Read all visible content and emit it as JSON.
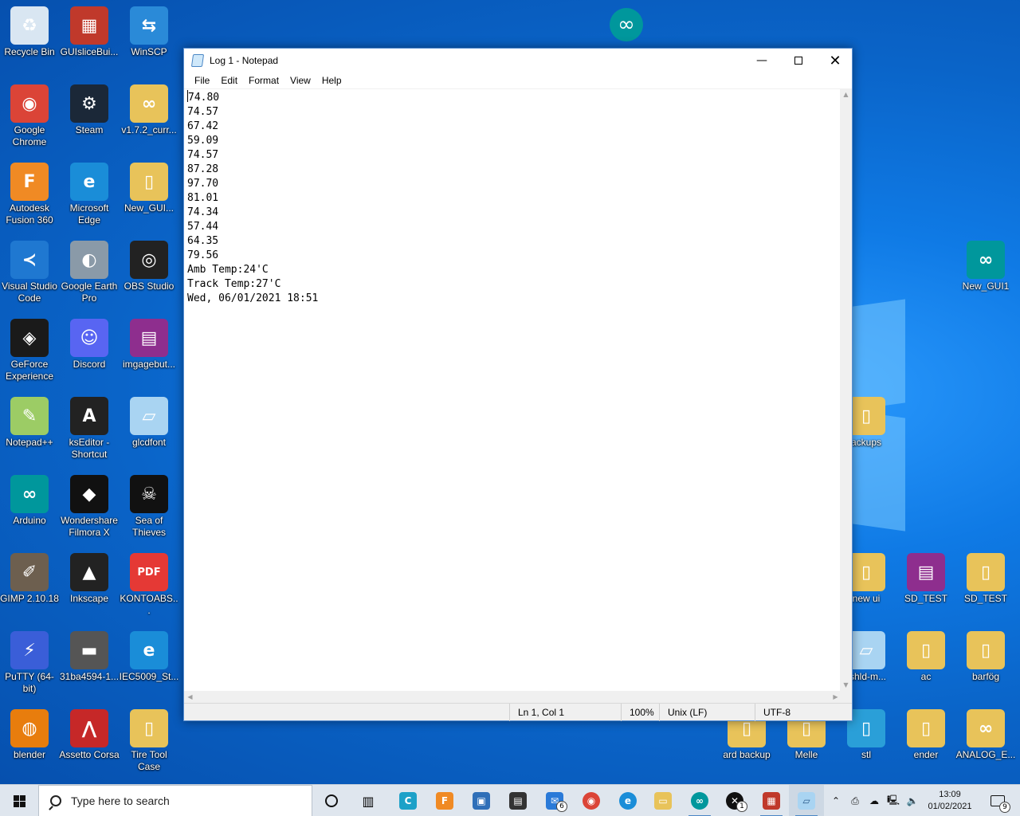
{
  "desktop": {
    "icons": [
      {
        "label": "Recycle Bin",
        "icon": "recycle-bin-icon",
        "color": "#d9e6f2",
        "glyph": "♻"
      },
      {
        "label": "GUIsliceBui...",
        "icon": "guislice-builder-icon",
        "color": "#c0392b",
        "glyph": "▦"
      },
      {
        "label": "WinSCP",
        "icon": "winscp-icon",
        "color": "#2a8ad8",
        "glyph": "⇆"
      },
      {
        "label": "Google Chrome",
        "icon": "chrome-icon",
        "color": "#db4437",
        "glyph": "◉"
      },
      {
        "label": "Steam",
        "icon": "steam-icon",
        "color": "#1b2838",
        "glyph": "⚙"
      },
      {
        "label": "v1.7.2_curr...",
        "icon": "folder-arduino-icon",
        "color": "#e8c35a",
        "glyph": "∞"
      },
      {
        "label": "Autodesk Fusion 360",
        "icon": "fusion360-icon",
        "color": "#f08a24",
        "glyph": "F"
      },
      {
        "label": "Microsoft Edge",
        "icon": "edge-icon",
        "color": "#1a8dd8",
        "glyph": "e"
      },
      {
        "label": "New_GUI...",
        "icon": "folder-icon",
        "color": "#e8c35a",
        "glyph": "▯"
      },
      {
        "label": "Visual Studio Code",
        "icon": "vscode-icon",
        "color": "#1f78d1",
        "glyph": "≺"
      },
      {
        "label": "Google Earth Pro",
        "icon": "google-earth-icon",
        "color": "#8a9aa8",
        "glyph": "◐"
      },
      {
        "label": "OBS Studio",
        "icon": "obs-icon",
        "color": "#222222",
        "glyph": "◎"
      },
      {
        "label": "GeForce Experience",
        "icon": "geforce-icon",
        "color": "#1a1a1a",
        "glyph": "◈"
      },
      {
        "label": "Discord",
        "icon": "discord-icon",
        "color": "#5865f2",
        "glyph": "☺"
      },
      {
        "label": "imgagebut...",
        "icon": "winrar-icon",
        "color": "#8e2e8e",
        "glyph": "▤"
      },
      {
        "label": "Notepad++",
        "icon": "notepadpp-icon",
        "color": "#9ccc65",
        "glyph": "✎"
      },
      {
        "label": "ksEditor - Shortcut",
        "icon": "kseditor-icon",
        "color": "#222222",
        "glyph": "A"
      },
      {
        "label": "glcdfont",
        "icon": "notepad-file-icon",
        "color": "#a9d4f2",
        "glyph": "▱"
      },
      {
        "label": "Arduino",
        "icon": "arduino-icon",
        "color": "#00979c",
        "glyph": "∞"
      },
      {
        "label": "Wondershare Filmora X",
        "icon": "filmora-icon",
        "color": "#111111",
        "glyph": "◆"
      },
      {
        "label": "Sea of Thieves",
        "icon": "sea-of-thieves-icon",
        "color": "#111111",
        "glyph": "☠"
      },
      {
        "label": "GIMP 2.10.18",
        "icon": "gimp-icon",
        "color": "#6d5f4f",
        "glyph": "✐"
      },
      {
        "label": "Inkscape",
        "icon": "inkscape-icon",
        "color": "#222222",
        "glyph": "▲"
      },
      {
        "label": "KONTOABS...",
        "icon": "pdf-icon",
        "color": "#e53935",
        "glyph": "PDF"
      },
      {
        "label": "PuTTY (64-bit)",
        "icon": "putty-icon",
        "color": "#3a5ed8",
        "glyph": "⚡"
      },
      {
        "label": "31ba4594-1...",
        "icon": "image-file-icon",
        "color": "#555555",
        "glyph": "▬"
      },
      {
        "label": "IEC5009_St...",
        "icon": "edge-file-icon",
        "color": "#1a8dd8",
        "glyph": "e"
      },
      {
        "label": "blender",
        "icon": "blender-icon",
        "color": "#e87d0d",
        "glyph": "◍"
      },
      {
        "label": "Assetto Corsa",
        "icon": "assetto-corsa-icon",
        "color": "#c62828",
        "glyph": "⋀"
      },
      {
        "label": "Tire Tool Case",
        "icon": "folder-icon",
        "color": "#e8c35a",
        "glyph": "▯"
      },
      {
        "label": "New_GUI1",
        "icon": "arduino-icon",
        "color": "#00979c",
        "glyph": "∞"
      },
      {
        "label": "ackups",
        "icon": "folder-icon",
        "color": "#e8c35a",
        "glyph": "▯"
      },
      {
        "label": "new ui",
        "icon": "folder-icon",
        "color": "#e8c35a",
        "glyph": "▯"
      },
      {
        "label": "SD_TEST",
        "icon": "winrar-icon",
        "color": "#8e2e8e",
        "glyph": "▤"
      },
      {
        "label": "SD_TEST",
        "icon": "folder-icon",
        "color": "#e8c35a",
        "glyph": "▯"
      },
      {
        "label": "-shld-m...",
        "icon": "notepad-file-icon",
        "color": "#a9d4f2",
        "glyph": "▱"
      },
      {
        "label": "ac",
        "icon": "folder-icon",
        "color": "#e8c35a",
        "glyph": "▯"
      },
      {
        "label": "barfög",
        "icon": "folder-icon",
        "color": "#e8c35a",
        "glyph": "▯"
      },
      {
        "label": "ard backup",
        "icon": "folder-icon",
        "color": "#e8c35a",
        "glyph": "▯"
      },
      {
        "label": "Melle",
        "icon": "folder-icon",
        "color": "#e8c35a",
        "glyph": "▯"
      },
      {
        "label": "stl",
        "icon": "folder-icon",
        "color": "#2a9fd8",
        "glyph": "▯"
      },
      {
        "label": "ender",
        "icon": "folder-icon",
        "color": "#e8c35a",
        "glyph": "▯"
      },
      {
        "label": "ANALOG_E...",
        "icon": "folder-arduino-icon",
        "color": "#e8c35a",
        "glyph": "∞"
      }
    ]
  },
  "notepad": {
    "title": "Log 1 - Notepad",
    "menu": [
      "File",
      "Edit",
      "Format",
      "View",
      "Help"
    ],
    "lines": [
      "74.80",
      "74.57",
      "67.42",
      "59.09",
      "74.57",
      "87.28",
      "97.70",
      "81.01",
      "74.34",
      "57.44",
      "64.35",
      "79.56",
      "Amb Temp:24'C",
      "Track Temp:27'C",
      "Wed, 06/01/2021 18:51"
    ],
    "status": {
      "position": "Ln 1, Col 1",
      "zoom": "100%",
      "line_ending": "Unix (LF)",
      "encoding": "UTF-8"
    }
  },
  "taskbar": {
    "search_placeholder": "Type here to search",
    "mail_badge": "6",
    "xbox_badge": "1",
    "time": "13:09",
    "date": "01/02/2021",
    "notification_count": "9"
  }
}
